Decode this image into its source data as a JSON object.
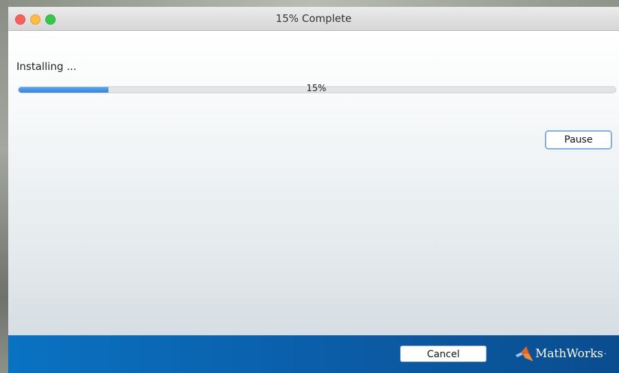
{
  "window": {
    "title": "15% Complete"
  },
  "install": {
    "status_label": "Installing ...",
    "progress_value": 0.15,
    "progress_text": "15%",
    "pause_label": "Pause"
  },
  "footer": {
    "cancel_label": "Cancel",
    "brand_name": "MathWorks",
    "brand_mark": "·",
    "logo_icon": "mathworks-membrane-logo"
  },
  "colors": {
    "progress_fill": "#2f86e0",
    "footer_blue": "#0b5ea9",
    "close_red": "#fc605b",
    "minimize_yellow": "#fdbc40",
    "maximize_green": "#34c84a"
  }
}
